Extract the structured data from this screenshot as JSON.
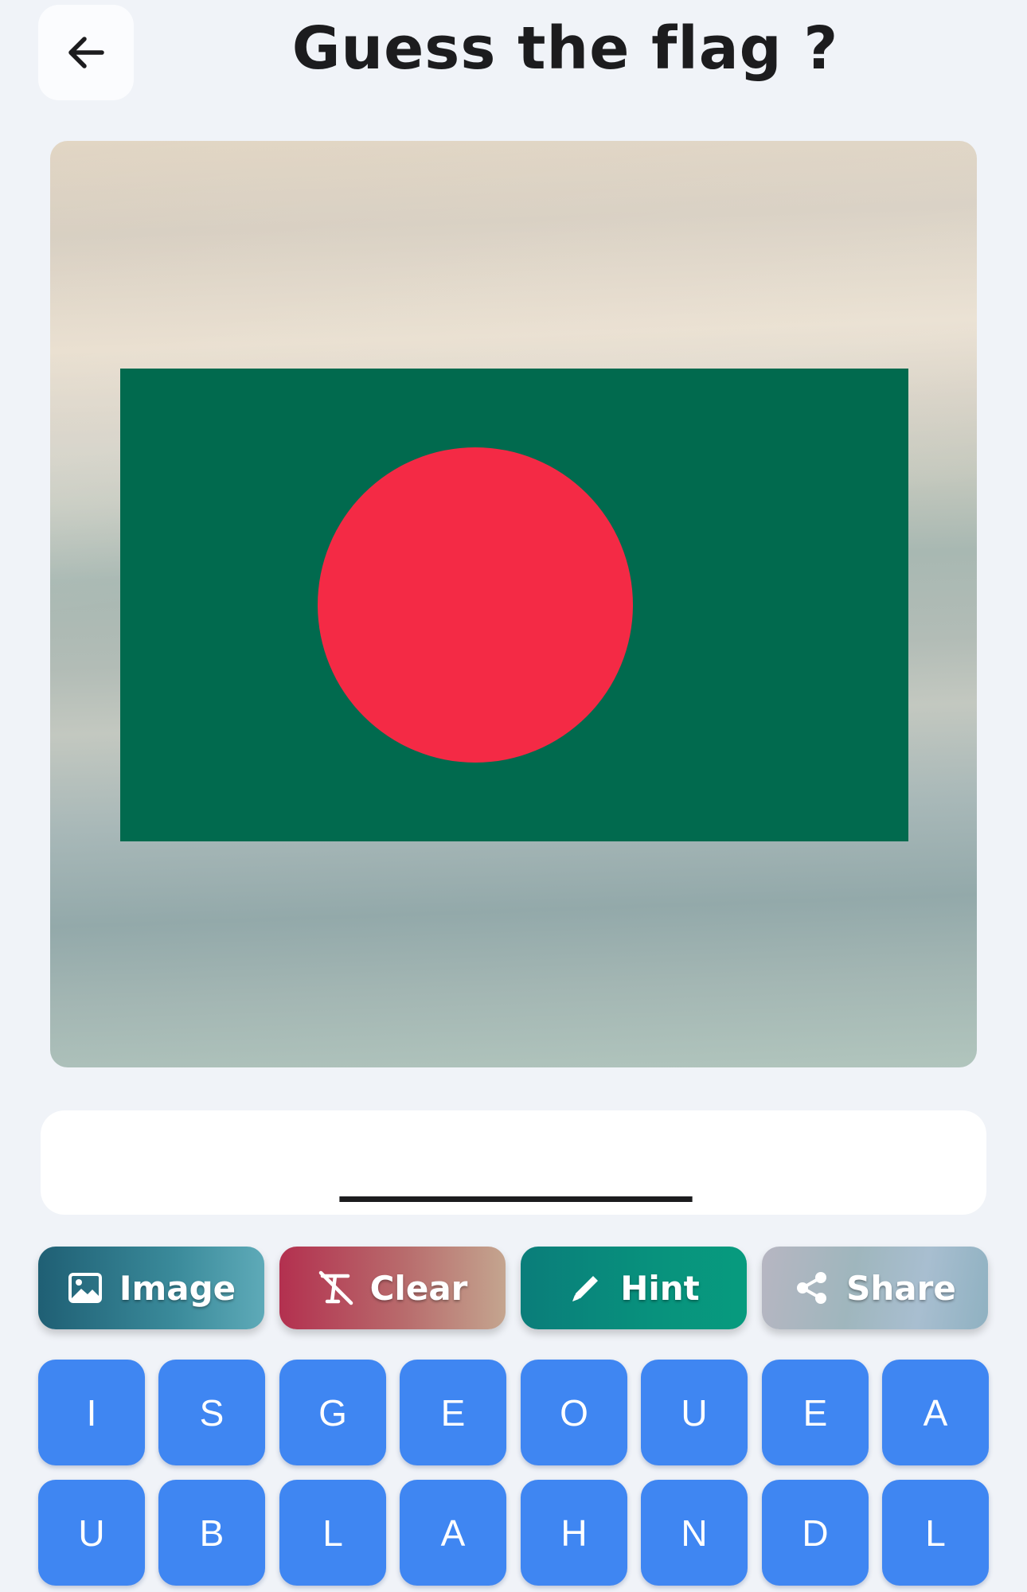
{
  "header": {
    "back_icon": "arrow-left-icon",
    "title": "Guess the flag ?"
  },
  "flag": {
    "field_color": "#016a4e",
    "disc_color": "#f42a45"
  },
  "answer": {
    "value": "___________"
  },
  "actions": [
    {
      "label": "Image",
      "icon": "image-icon"
    },
    {
      "label": "Clear",
      "icon": "clear-format-icon"
    },
    {
      "label": "Hint",
      "icon": "pencil-icon"
    },
    {
      "label": "Share",
      "icon": "share-icon"
    }
  ],
  "keyboard": {
    "row1": [
      "I",
      "S",
      "G",
      "E",
      "O",
      "U",
      "E",
      "A"
    ],
    "row2": [
      "U",
      "B",
      "L",
      "A",
      "H",
      "N",
      "D",
      "L"
    ]
  }
}
